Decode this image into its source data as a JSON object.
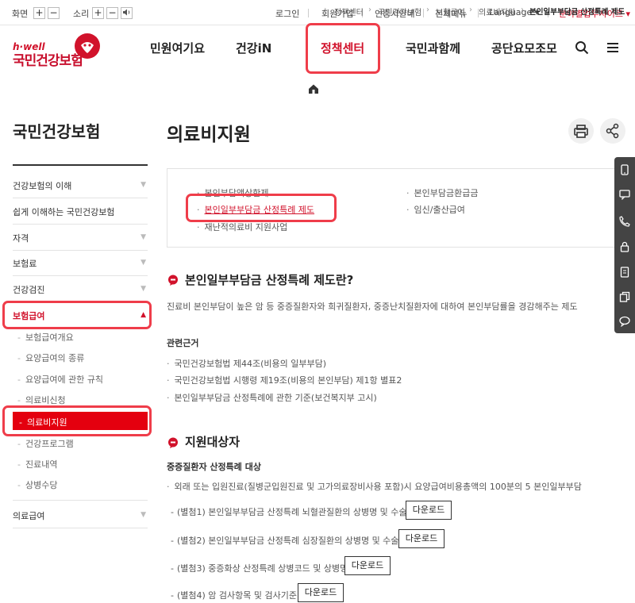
{
  "util": {
    "screen_label": "화면",
    "sound_label": "소리",
    "plus": "+",
    "minus": "−",
    "links": [
      "로그인",
      "회원가입",
      "인증서안내",
      "전체메뉴",
      "Language ▾"
    ],
    "site_link": "분야별업무사이트 ▾"
  },
  "logo": {
    "tagline": "h·well",
    "name": "국민건강보험"
  },
  "gnb": [
    "민원여기요",
    "건강iN",
    "정책센터",
    "국민과함께",
    "공단요모조모"
  ],
  "breadcrumb": [
    "정책센터",
    "국민건강보험",
    "보험급여",
    "의료비지원",
    "본인일부부담금 산정특례 제도"
  ],
  "sidebar": {
    "title": "국민건강보험",
    "items": [
      "건강보험의 이해",
      "쉽게 이해하는 국민건강보험",
      "자격",
      "보험료",
      "건강검진",
      "보험급여",
      "의료급여"
    ],
    "sub": [
      "보험급여개요",
      "요양급여의 종류",
      "요양급여에 관한 규칙",
      "의료비신청",
      "의료비지원",
      "건강프로그램",
      "진료내역",
      "상병수당"
    ]
  },
  "main": {
    "title": "의료비지원",
    "links_left": [
      "본인부담액상한제",
      "본인일부부담금 산정특례 제도",
      "재난적의료비 지원사업"
    ],
    "links_right": [
      "본인부담금환급금",
      "임신/출산급여"
    ],
    "section1": {
      "title": "본인일부부담금 산정특례 제도란?",
      "desc": "진료비 본인부담이 높은 암 등 중증질환자와 희귀질환자, 중증난치질환자에 대하여 본인부담률을 경감해주는 제도",
      "basis_title": "관련근거",
      "basis": [
        "국민건강보험법 제44조(비용의 일부부담)",
        "국민건강보험법 시행령 제19조(비용의 본인부담) 제1항 별표2",
        "본인일부부담금 산정특례에 관한 기준(보건복지부 고시)"
      ]
    },
    "section2": {
      "title": "지원대상자",
      "sub_title": "중증질환자 산정특례 대상",
      "desc": "외래 또는 입원진료(질병군입원진료 및 고가의료장비사용 포함)시 요양급여비용총액의 100분의 5 본인일부부담",
      "attachments": [
        "(별첨1) 본인일부부담금 산정특례 뇌혈관질환의 상병명 및 수술명",
        "(별첨2) 본인일부부담금 산정특례 심장질환의 상병명 및 수술명",
        "(별첨3) 중증화상 산정특례 상병코드 및 상병명",
        "(별첨4) 암 검사항목 및 검사기준"
      ],
      "download_label": "다운로드"
    }
  },
  "colors": {
    "brand_red": "#d1122b",
    "highlight": "#ef3d4a",
    "active_bg": "#e4000f"
  }
}
